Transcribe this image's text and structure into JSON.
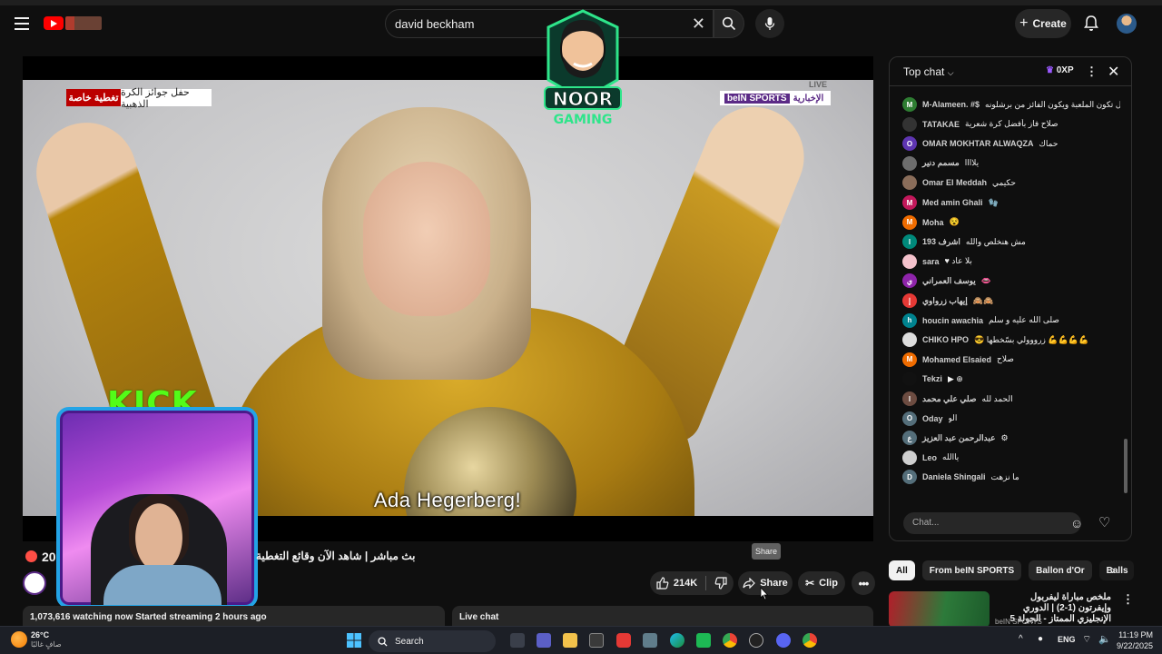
{
  "header": {
    "search_value": "david beckham",
    "create_label": "Create"
  },
  "overlay": {
    "noor_line1": "NOOR",
    "noor_line2": "GAMING",
    "kick_label": "KICK"
  },
  "video": {
    "tag_red": "تغطية خاصة",
    "tag_white": "حفل جوائز الكرة الذهبية",
    "bein_left": "الإخبارية",
    "bein_brand": "beIN SPORTS",
    "live_small": "LIVE",
    "subtitle": "Ada Hegerberg!"
  },
  "below_video": {
    "viewers_short": "20",
    "title": "بث مباشر | شاهد الآن وقائع التغطية",
    "like_count": "214K",
    "share_label": "Share",
    "clip_label": "Clip",
    "tooltip": "Share",
    "description": "1,073,616 watching now  Started streaming 2 hours ago",
    "live_chat_label": "Live chat"
  },
  "chat": {
    "title": "Top chat",
    "xp": "0XP",
    "input_placeholder": "Chat...",
    "messages": [
      {
        "initial": "M",
        "color": "#2e7d32",
        "author": "M-Alameen. #$",
        "text": "احتمال تكون الملعبة ويكون الفائز من برشلونه"
      },
      {
        "initial": "",
        "color": "#333333",
        "author": "TATAKAE",
        "text": "صلاح فاز بأفضل كرة شعرية"
      },
      {
        "initial": "O",
        "color": "#5e35b1",
        "author": "OMAR MOKHTAR ALWAQZA",
        "text": "حماك"
      },
      {
        "initial": "",
        "color": "#6d6d6d",
        "author": "مسمم دنير",
        "text": "يلاااا"
      },
      {
        "initial": "",
        "color": "#8a6d5a",
        "author": "Omar El Meddah",
        "text": "حكيمي"
      },
      {
        "initial": "M",
        "color": "#c2185b",
        "author": "Med amin Ghali",
        "text": "🧤"
      },
      {
        "initial": "M",
        "color": "#ef6c00",
        "author": "Moha",
        "text": "😵"
      },
      {
        "initial": "I",
        "color": "#00897b",
        "author": "اشرف 193",
        "text": "مش هنخلص والله"
      },
      {
        "initial": "",
        "color": "#f4c2cc",
        "author": "sara",
        "text": "♥ بلا عاد"
      },
      {
        "initial": "ي",
        "color": "#8e24aa",
        "author": "يوسف العمراني",
        "text": "👄"
      },
      {
        "initial": "إ",
        "color": "#e53935",
        "author": "إيهاب زرواوي",
        "text": "🙈🙈"
      },
      {
        "initial": "h",
        "color": "#00838f",
        "author": "houcin awachia",
        "text": "صلى الله عليه و سلم"
      },
      {
        "initial": "",
        "color": "#dddddd",
        "author": "CHIKO HPO",
        "text": "😎 زرووولي بسّخطها 💪💪💪💪"
      },
      {
        "initial": "M",
        "color": "#ef6c00",
        "author": "Mohamed Elsaied",
        "text": "صلاح"
      },
      {
        "initial": "",
        "color": "#111111",
        "author": "Tekzi",
        "text": "▶ ⊕"
      },
      {
        "initial": "I",
        "color": "#6d4c41",
        "author": "صلي علي محمد",
        "text": "الحمد لله"
      },
      {
        "initial": "O",
        "color": "#546e7a",
        "author": "Oday",
        "text": "الو"
      },
      {
        "initial": "ع",
        "color": "#546e7a",
        "author": "عبدالرحمن عبد العزيز",
        "text": "⚙"
      },
      {
        "initial": "",
        "color": "#cfcfcf",
        "author": "Leo",
        "text": "ياالله"
      },
      {
        "initial": "D",
        "color": "#546e7a",
        "author": "Daniela Shingali",
        "text": "ما نزهت"
      }
    ]
  },
  "related": {
    "chips": [
      "All",
      "From beIN SPORTS",
      "Ballon d'Or",
      "Balls"
    ],
    "title": "ملخص مباراة ليفربول وإيفرتون (1-2) | الدوري الإنجليزي الممتاز - الجولة 5",
    "channel": "beIN SPORTS"
  },
  "taskbar": {
    "weather_temp": "26°C",
    "weather_desc": "صافٍ غالبًا",
    "search_label": "Search",
    "lang": "ENG",
    "time": "11:19 PM",
    "date": "9/22/2025"
  }
}
